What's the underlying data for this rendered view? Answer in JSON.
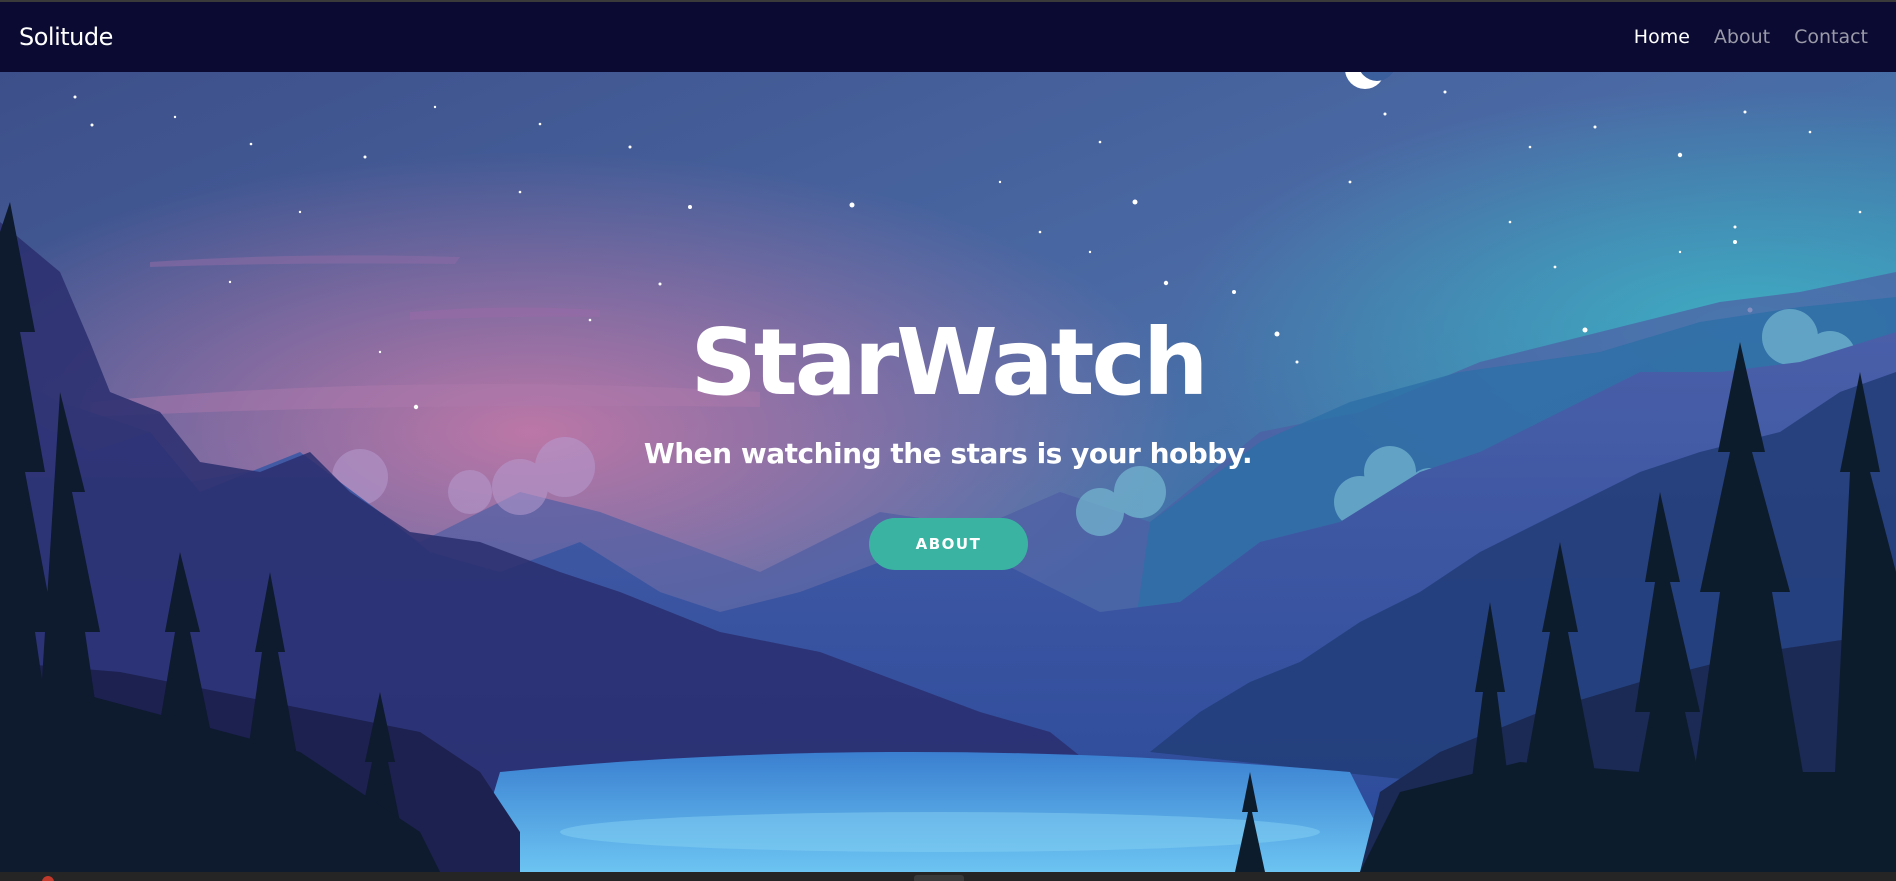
{
  "navbar": {
    "brand": "Solitude",
    "links": [
      {
        "label": "Home",
        "active": true
      },
      {
        "label": "About",
        "active": false
      },
      {
        "label": "Contact",
        "active": false
      }
    ]
  },
  "hero": {
    "title": "StarWatch",
    "subtitle": "When watching the stars is your hobby.",
    "button_label": "ABOUT"
  },
  "colors": {
    "navbar_bg": "#0a0a33",
    "button_accent": "#3ab3a2",
    "inactive_link": "#9a9aa8"
  },
  "icons": {
    "moon": "crescent-moon"
  }
}
